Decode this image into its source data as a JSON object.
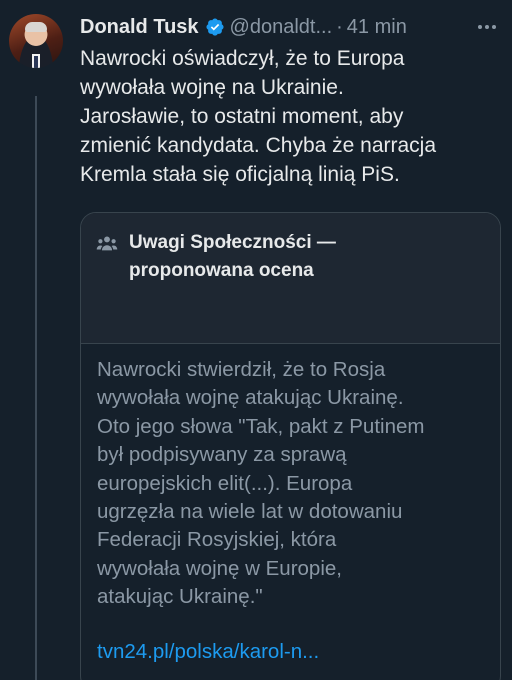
{
  "tweet": {
    "author_name": "Donald Tusk",
    "handle": "@donaldt...",
    "separator": "·",
    "time": "41 min",
    "text_lines": [
      "Nawrocki oświadczył, że to Europa",
      "wywołała wojnę na Ukrainie.",
      "Jarosławie, to ostatni moment, aby",
      "zmienić kandydata. Chyba że narracja",
      "Kremla stała się oficjalną linią PiS."
    ]
  },
  "community_note": {
    "title_lines": [
      "Uwagi Społeczności —",
      "proponowana ocena"
    ],
    "body_lines": [
      "Nawrocki stwierdził, że to Rosja",
      "wywołała wojnę atakując Ukrainę.",
      "Oto jego słowa \"Tak, pakt z Putinem",
      "był podpisywany za sprawą",
      "europejskich elit(...). Europa",
      "ugrzęzła na wiele lat w dotowaniu",
      "Federacji Rosyjskiej, która",
      "wywołała wojnę w Europie,",
      "atakując Ukrainę.\""
    ],
    "link": "tvn24.pl/polska/karol-n..."
  },
  "icons": {
    "verified": "verified-badge-icon",
    "more": "more-options-icon",
    "community": "community-notes-people-icon"
  },
  "colors": {
    "background": "#15202b",
    "text_primary": "#e7e9ea",
    "text_secondary": "#8b98a5",
    "link": "#1d9bf0",
    "verified": "#1d9bf0",
    "border": "#38444d"
  }
}
